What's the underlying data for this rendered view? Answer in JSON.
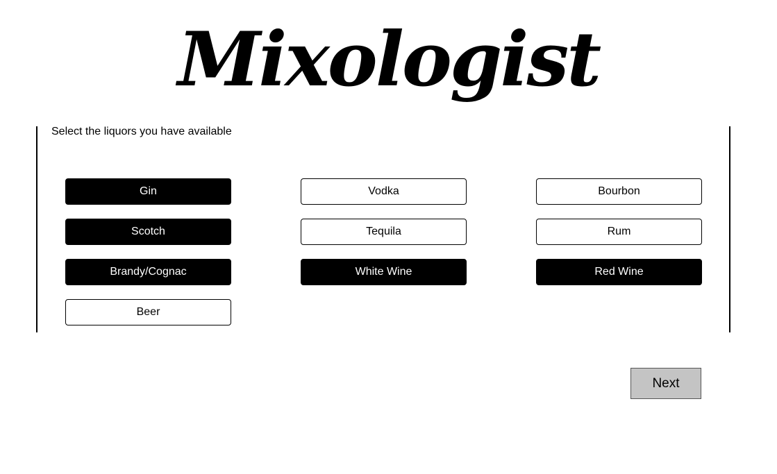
{
  "app": {
    "logo_text": "Mixologist"
  },
  "selection": {
    "prompt": "Select the liquors you have available",
    "options": [
      {
        "label": "Gin",
        "selected": true
      },
      {
        "label": "Vodka",
        "selected": false
      },
      {
        "label": "Bourbon",
        "selected": false
      },
      {
        "label": "Scotch",
        "selected": true
      },
      {
        "label": "Tequila",
        "selected": false
      },
      {
        "label": "Rum",
        "selected": false
      },
      {
        "label": "Brandy/Cognac",
        "selected": true
      },
      {
        "label": "White Wine",
        "selected": true
      },
      {
        "label": "Red Wine",
        "selected": true
      },
      {
        "label": "Beer",
        "selected": false
      }
    ]
  },
  "actions": {
    "next_label": "Next"
  },
  "colors": {
    "selected_bg": "#000000",
    "selected_text": "#ffffff",
    "unselected_bg": "#ffffff",
    "next_button_bg": "#c4c4c4"
  }
}
